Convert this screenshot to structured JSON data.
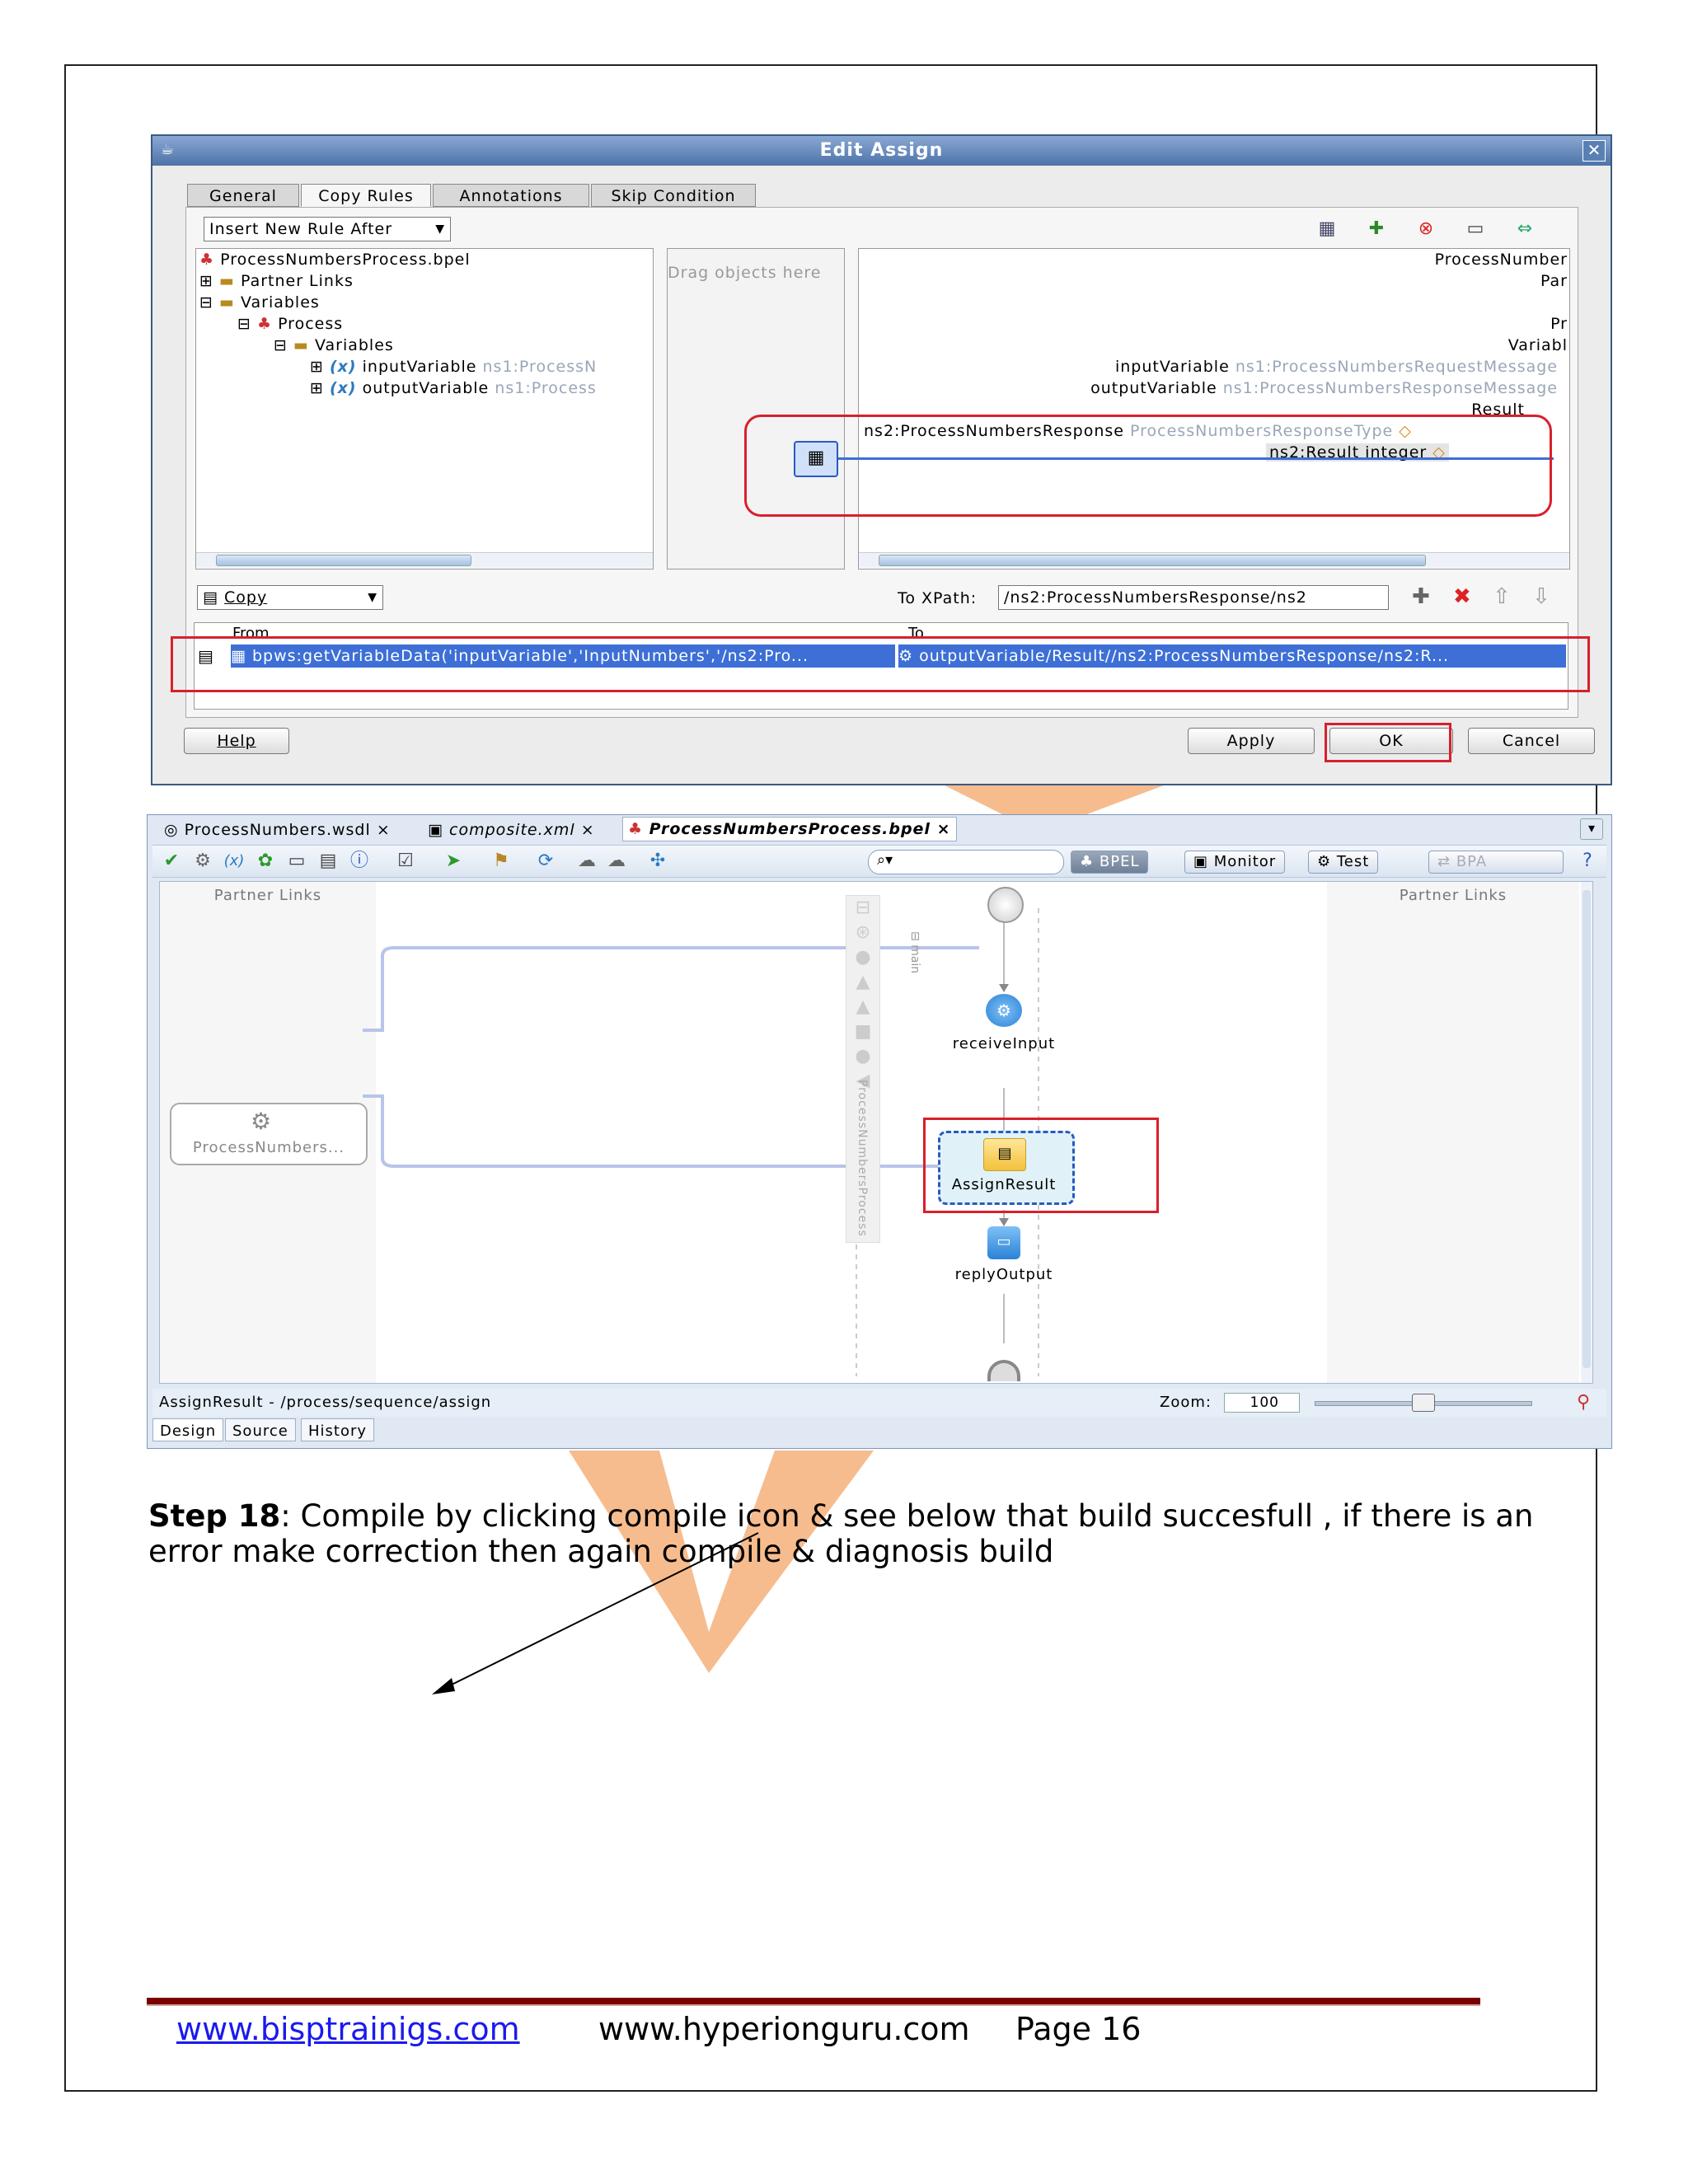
{
  "dialog": {
    "title": "Edit Assign",
    "tabs": [
      "General",
      "Copy Rules",
      "Annotations",
      "Skip Condition"
    ],
    "insert_rule": "Insert New Rule After",
    "source_tree": {
      "root": "ProcessNumbersProcess.bpel",
      "partner_links": "Partner Links",
      "variables": "Variables",
      "process": "Process",
      "inner_variables": "Variables",
      "input_var": "inputVariable",
      "input_type": "ns1:ProcessN",
      "output_var": "outputVariable",
      "output_type": "ns1:Process"
    },
    "drag_hint": "Drag objects here",
    "target_tree": {
      "root": "ProcessNumber",
      "partner": "Par",
      "process": "Pr",
      "variables": "Variabl",
      "input_var": "inputVariable",
      "input_type": "ns1:ProcessNumbersRequestMessage",
      "output_var": "outputVariable",
      "output_type": "ns1:ProcessNumbersResponseMessage",
      "result": "Result",
      "response": "ns2:ProcessNumbersResponse",
      "response_type": "ProcessNumbersResponseType",
      "result_int": "ns2:Result integer"
    },
    "copy_combo": "Copy",
    "to_xpath_label": "To XPath:",
    "to_xpath_value": "/ns2:ProcessNumbersResponse/ns2",
    "grid_from_header": "From",
    "grid_to_header": "To",
    "row_from": "bpws:getVariableData('inputVariable','InputNumbers','/ns2:Pro...",
    "row_to": "outputVariable/Result//ns2:ProcessNumbersResponse/ns2:R...",
    "help": "Help",
    "apply": "Apply",
    "ok": "OK",
    "cancel": "Cancel"
  },
  "ide": {
    "tabs": [
      "ProcessNumbers.wsdl",
      "composite.xml",
      "ProcessNumbersProcess.bpel"
    ],
    "toolbar_buttons": [
      "BPEL",
      "Monitor",
      "Test",
      "BPA"
    ],
    "partner_links_left": "Partner Links",
    "partner_links_right": "Partner Links",
    "partner_node": "ProcessNumbers...",
    "scope_label": "main",
    "process_label": "ProcessNumbersProcess",
    "nodes": [
      "receiveInput",
      "AssignResult",
      "replyOutput"
    ],
    "status_path": "AssignResult - /process/sequence/assign",
    "zoom_label": "Zoom:",
    "zoom_value": "100",
    "bottom_tabs": [
      "Design",
      "Source",
      "History"
    ]
  },
  "step": {
    "label": "Step 18",
    "text": ": Compile by clicking compile icon   & see below that build succesfull , if there is an error make correction then again compile & diagnosis build"
  },
  "footer": {
    "link": "www.bisptrainigs.com",
    "site": "www.hyperionguru.com",
    "page": "Page 16"
  },
  "colors": {
    "highlight_red": "#d8202c",
    "selection_blue": "#3d6fd6",
    "watermark_orange": "#f0a060",
    "footer_rule": "#7a0000"
  }
}
